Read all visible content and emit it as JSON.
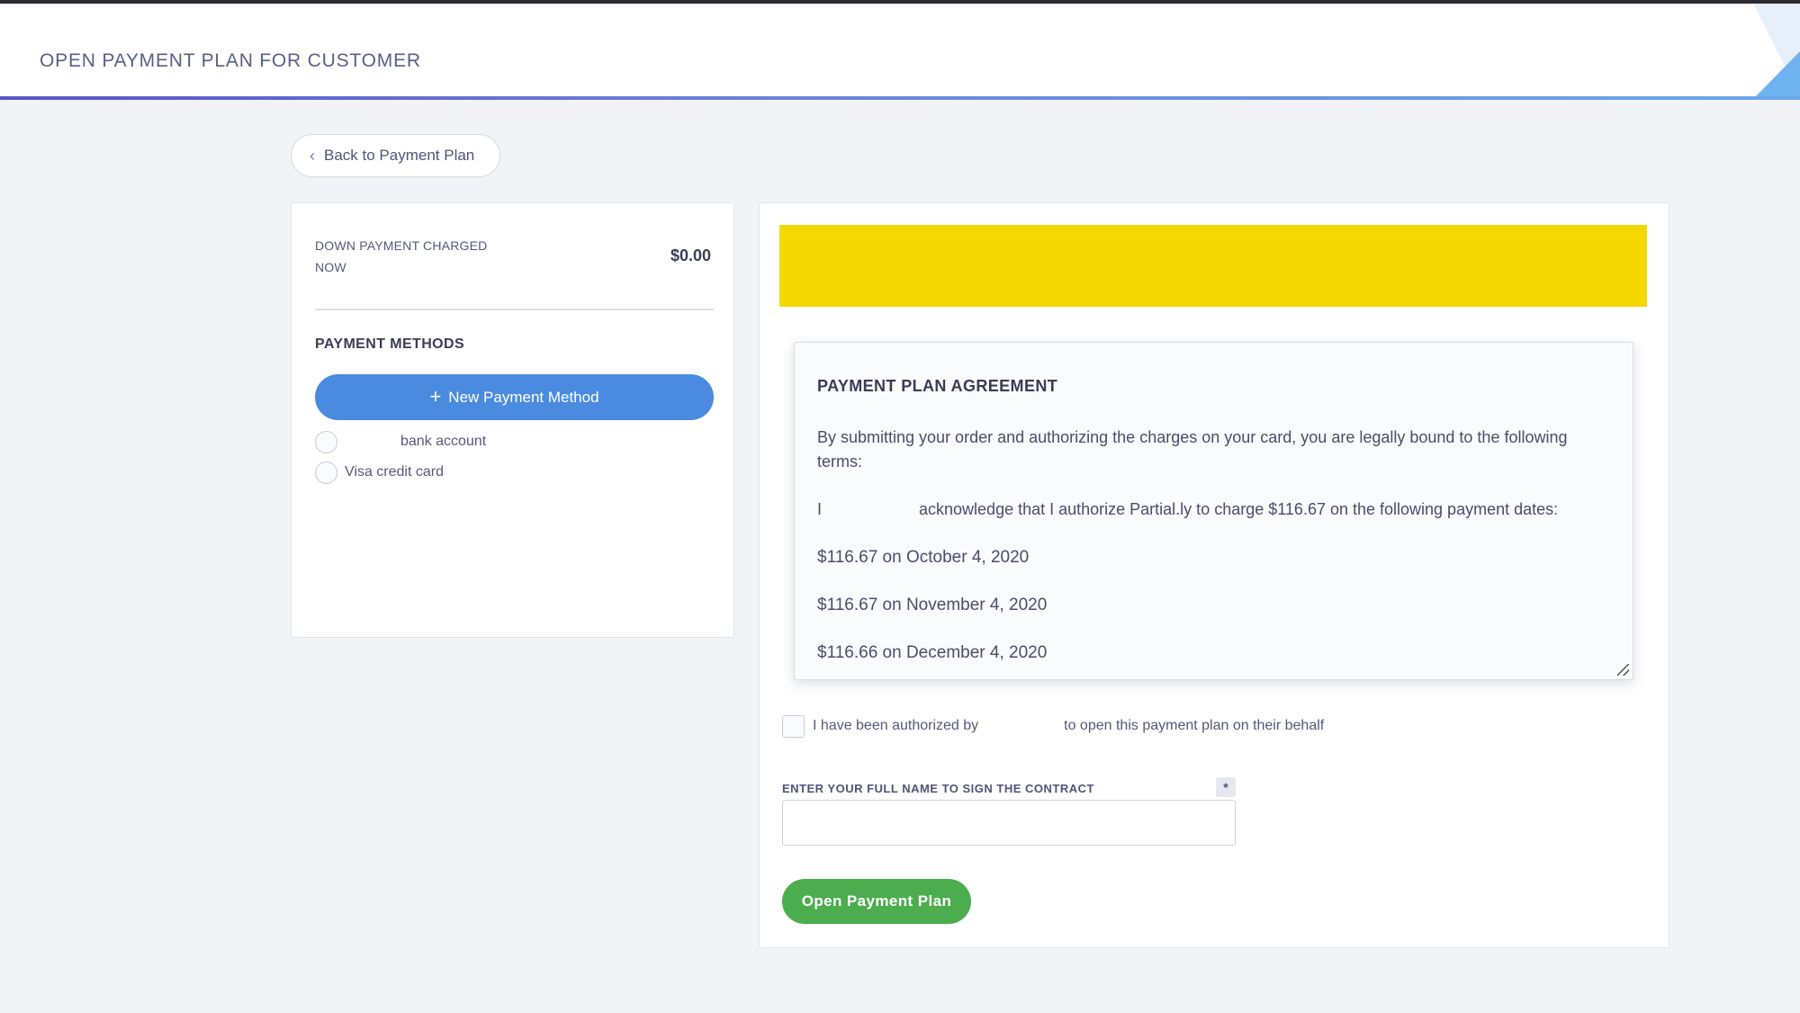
{
  "header": {
    "title": "OPEN PAYMENT PLAN FOR CUSTOMER"
  },
  "back_button": {
    "label": "Back to Payment Plan"
  },
  "summary": {
    "down_payment_label": "DOWN PAYMENT CHARGED NOW",
    "down_payment_amount": "$0.00"
  },
  "payment_methods": {
    "title": "PAYMENT METHODS",
    "new_button_label": "New Payment Method",
    "options": [
      {
        "label": "bank account",
        "selected": false
      },
      {
        "label": "Visa credit card",
        "selected": false
      }
    ]
  },
  "agreement": {
    "title": "PAYMENT PLAN AGREEMENT",
    "intro": "By submitting your order and authorizing the charges on your card, you are legally bound to the following terms:",
    "ack_prefix": "I",
    "ack_text": "acknowledge that I authorize Partial.ly to charge $116.67 on the following payment dates:",
    "payments": [
      "$116.67 on October 4, 2020",
      "$116.67 on November 4, 2020",
      "$116.66 on December 4, 2020"
    ]
  },
  "authorization": {
    "prefix": "I have been authorized by",
    "suffix": "to open this payment plan on their behalf",
    "checked": false
  },
  "signature": {
    "label": "ENTER YOUR FULL NAME TO SIGN THE CONTRACT",
    "required_marker": "*",
    "value": ""
  },
  "submit": {
    "label": "Open Payment Plan"
  },
  "colors": {
    "primary_blue": "#4a8be0",
    "success_green": "#4cad4f",
    "banner_yellow": "#f4d800",
    "header_accent": "#5a55c8"
  }
}
